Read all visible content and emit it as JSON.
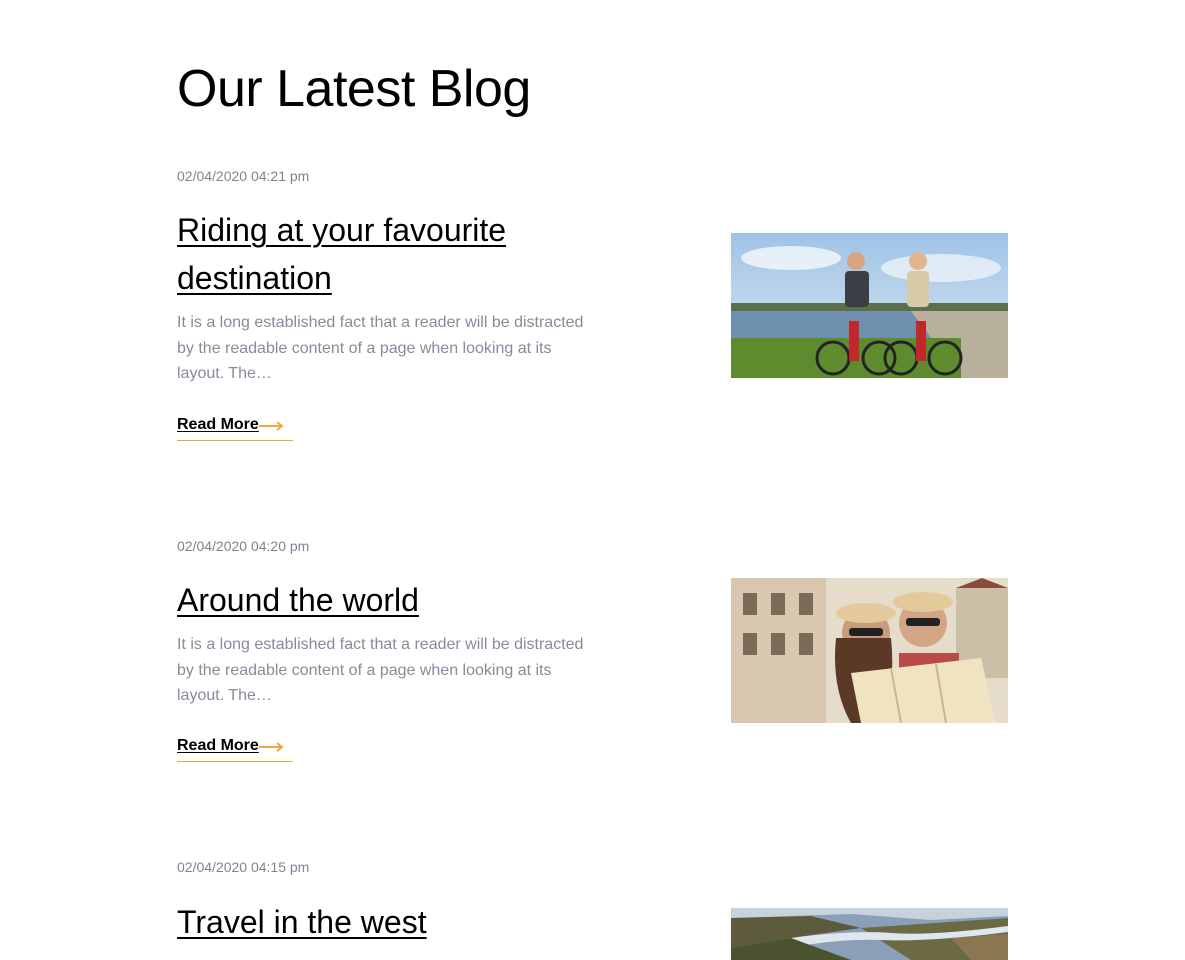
{
  "section": {
    "title": "Our Latest Blog"
  },
  "posts": [
    {
      "date": "02/04/2020 04:21 pm",
      "title": "Riding at your favourite destination",
      "excerpt": "It is a long established fact that a reader will be distracted by the readable content of a page when looking at its layout. The…",
      "read_more": "Read More",
      "image_icon": "cyclists-photo"
    },
    {
      "date": "02/04/2020 04:20 pm",
      "title": "Around the world",
      "excerpt": "It is a long established fact that a reader will be distracted by the readable content of a page when looking at its layout. The…",
      "read_more": "Read More",
      "image_icon": "tourists-map-photo"
    },
    {
      "date": "02/04/2020 04:15 pm",
      "title": "Travel in the west",
      "excerpt": "",
      "read_more": "",
      "image_icon": "river-valley-photo"
    }
  ],
  "colors": {
    "accent": "#f0a83a",
    "muted_text": "#858c99",
    "date_text": "#7d8594"
  }
}
